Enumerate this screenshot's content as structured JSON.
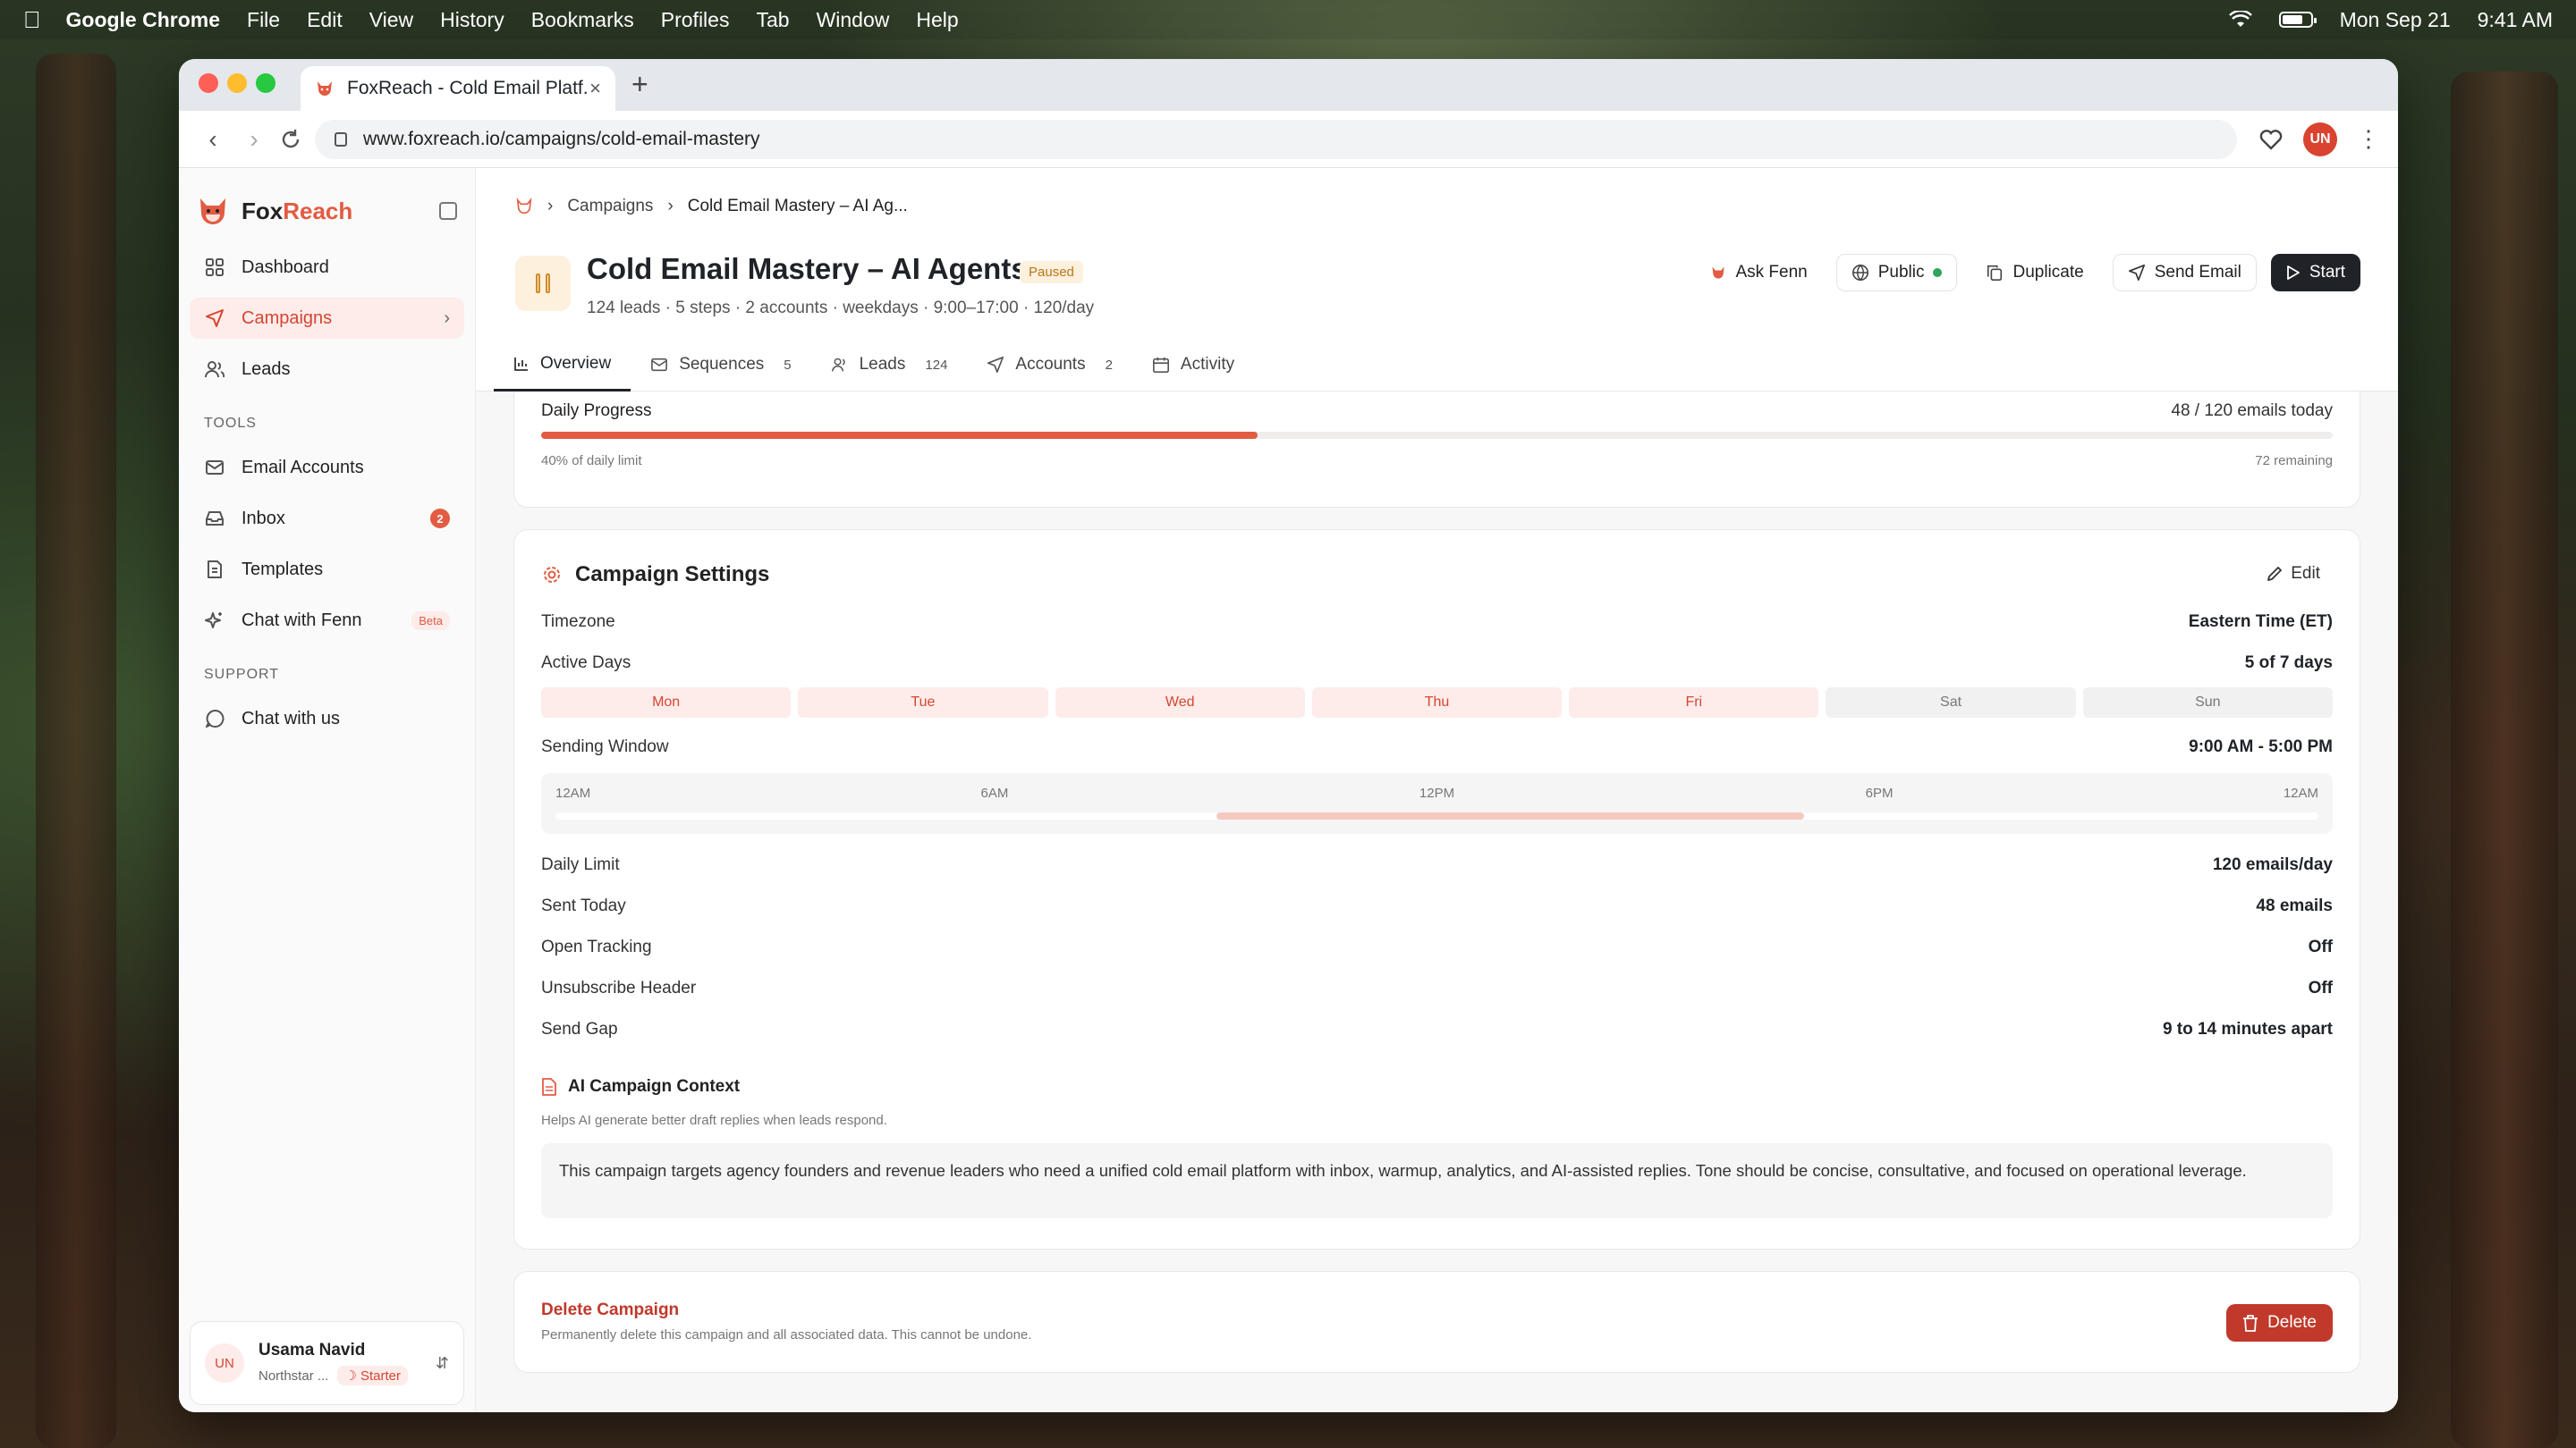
{
  "menubar": {
    "app": "Google Chrome",
    "items": [
      "File",
      "Edit",
      "View",
      "History",
      "Bookmarks",
      "Profiles",
      "Tab",
      "Window",
      "Help"
    ],
    "date": "Mon Sep 21",
    "time": "9:41 AM"
  },
  "browser": {
    "tab_title": "FoxReach - Cold Email Platf...",
    "url": "www.foxreach.io/campaigns/cold-email-mastery",
    "profile_initials": "UN"
  },
  "sidebar": {
    "brand_part1": "Fox",
    "brand_part2": "Reach",
    "nav": [
      {
        "label": "Dashboard",
        "icon": "grid-icon"
      },
      {
        "label": "Campaigns",
        "icon": "send-icon"
      },
      {
        "label": "Leads",
        "icon": "users-icon"
      }
    ],
    "tools_title": "TOOLS",
    "tools": [
      {
        "label": "Email Accounts",
        "icon": "mail-icon"
      },
      {
        "label": "Inbox",
        "icon": "inbox-icon",
        "badge": "2"
      },
      {
        "label": "Templates",
        "icon": "document-icon"
      },
      {
        "label": "Chat with Fenn",
        "icon": "sparkle-icon",
        "tag": "Beta"
      }
    ],
    "support_title": "SUPPORT",
    "support": [
      {
        "label": "Chat with us",
        "icon": "chat-icon"
      }
    ],
    "user": {
      "initials": "UN",
      "name": "Usama Navid",
      "org": "Northstar ...",
      "plan": "Starter"
    }
  },
  "header": {
    "breadcrumb": [
      "Campaigns",
      "Cold Email Mastery – AI Ag..."
    ],
    "title": "Cold Email Mastery – AI Agents",
    "status": "Paused",
    "meta": "124 leads · 5 steps · 2 accounts · weekdays · 9:00–17:00 · 120/day",
    "actions": {
      "ask": "Ask Fenn",
      "public": "Public",
      "duplicate": "Duplicate",
      "send": "Send Email",
      "start": "Start"
    },
    "tabs": [
      {
        "label": "Overview",
        "count": ""
      },
      {
        "label": "Sequences",
        "count": "5"
      },
      {
        "label": "Leads",
        "count": "124"
      },
      {
        "label": "Accounts",
        "count": "2"
      },
      {
        "label": "Activity",
        "count": ""
      }
    ]
  },
  "progress": {
    "label": "Daily Progress",
    "value": "48 / 120 emails today",
    "fraction": 0.4,
    "sub": "40% of daily limit",
    "remaining": "72 remaining"
  },
  "settings": {
    "title": "Campaign Settings",
    "edit": "Edit",
    "timezone_label": "Timezone",
    "timezone": "Eastern Time (ET)",
    "active_days_label": "Active Days",
    "active_days": "5 of 7 days",
    "days": [
      {
        "label": "Mon",
        "on": true
      },
      {
        "label": "Tue",
        "on": true
      },
      {
        "label": "Wed",
        "on": true
      },
      {
        "label": "Thu",
        "on": true
      },
      {
        "label": "Fri",
        "on": true
      },
      {
        "label": "Sat",
        "on": false
      },
      {
        "label": "Sun",
        "on": false
      }
    ],
    "window_label": "Sending Window",
    "window": "9:00 AM - 5:00 PM",
    "window_start_hour": 9,
    "window_end_hour": 17,
    "window_ticks": [
      "12AM",
      "6AM",
      "12PM",
      "6PM",
      "12AM"
    ],
    "rows": [
      {
        "k": "Daily Limit",
        "v": "120 emails/day"
      },
      {
        "k": "Sent Today",
        "v": "48 emails"
      },
      {
        "k": "Open Tracking",
        "v": "Off"
      },
      {
        "k": "Unsubscribe Header",
        "v": "Off"
      },
      {
        "k": "Send Gap",
        "v": "9 to 14 minutes apart"
      }
    ],
    "ai_context_title": "AI Campaign Context",
    "ai_context_sub": "Helps AI generate better draft replies when leads respond.",
    "ai_context": "This campaign targets agency founders and revenue leaders who need a unified cold email platform with inbox, warmup, analytics, and AI-assisted replies. Tone should be concise, consultative, and focused on operational leverage."
  },
  "danger": {
    "title": "Delete Campaign",
    "sub": "Permanently delete this campaign and all associated data. This cannot be undone.",
    "button": "Delete"
  },
  "colors": {
    "accent": "#e25b42",
    "danger": "#c0392b",
    "paused": "#d08a28"
  }
}
